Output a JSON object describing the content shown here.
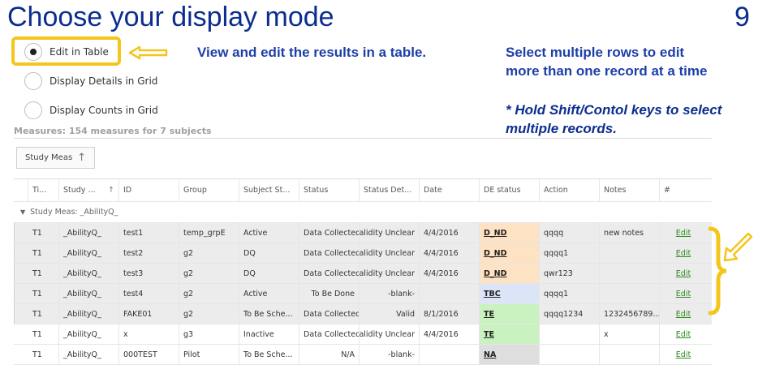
{
  "title": "Choose your display mode",
  "page_number": "9",
  "notes": {
    "view_edit": "View and edit the results in a table.",
    "select_multiple_line1": "Select multiple rows to edit",
    "select_multiple_line2": "more than one record at a time",
    "hold_keys_line1": "* Hold Shift/Contol keys to select",
    "hold_keys_line2": "multiple records."
  },
  "display_modes": [
    {
      "label": "Edit in Table",
      "selected": true
    },
    {
      "label": "Display Details in Grid",
      "selected": false
    },
    {
      "label": "Display Counts in Grid",
      "selected": false
    }
  ],
  "measures_summary": "Measures: 154 measures for 7 subjects",
  "group_by_button": "Study Meas",
  "columns": [
    "Ti...",
    "Study ...",
    "ID",
    "Group",
    "Subject St...",
    "Status",
    "Status Det...",
    "Date",
    "DE status",
    "Action",
    "Notes",
    "#"
  ],
  "group_label": "Study Meas: _AbilityQ_",
  "rows": [
    {
      "ti": "T1",
      "study": "_AbilityQ_",
      "id": "test1",
      "group": "temp_grpE",
      "subject_status": "Active",
      "status": "Data Collected",
      "status_detail": "Validity Unclear",
      "date": "4/4/2016",
      "de_status": "D_ND",
      "action": "qqqq",
      "notes": "new notes",
      "edit": "Edit"
    },
    {
      "ti": "T1",
      "study": "_AbilityQ_",
      "id": "test2",
      "group": "g2",
      "subject_status": "DQ",
      "status": "Data Collected",
      "status_detail": "Validity Unclear",
      "date": "4/4/2016",
      "de_status": "D_ND",
      "action": "qqqq1",
      "notes": "",
      "edit": "Edit"
    },
    {
      "ti": "T1",
      "study": "_AbilityQ_",
      "id": "test3",
      "group": "g2",
      "subject_status": "DQ",
      "status": "Data Collected",
      "status_detail": "Validity Unclear",
      "date": "4/4/2016",
      "de_status": "D_ND",
      "action": "qwr123",
      "notes": "",
      "edit": "Edit"
    },
    {
      "ti": "T1",
      "study": "_AbilityQ_",
      "id": "test4",
      "group": "g2",
      "subject_status": "Active",
      "status": "To Be Done",
      "status_detail": "-blank-",
      "date": "",
      "de_status": "TBC",
      "action": "qqqq1",
      "notes": "",
      "edit": "Edit"
    },
    {
      "ti": "T1",
      "study": "_AbilityQ_",
      "id": "FAKE01",
      "group": "g2",
      "subject_status": "To Be Sche...",
      "status": "Data Collected",
      "status_detail": "Valid",
      "date": "8/1/2016",
      "de_status": "TE",
      "action": "qqqq1234",
      "notes": "1232456789...",
      "edit": "Edit"
    },
    {
      "ti": "T1",
      "study": "_AbilityQ_",
      "id": "x",
      "group": "g3",
      "subject_status": "Inactive",
      "status": "Data Collected",
      "status_detail": "Validity Unclear",
      "date": "4/4/2016",
      "de_status": "TE",
      "action": "",
      "notes": "x",
      "edit": "Edit"
    },
    {
      "ti": "T1",
      "study": "_AbilityQ_",
      "id": "000TEST",
      "group": "Pilot",
      "subject_status": "To Be Sche...",
      "status": "N/A",
      "status_detail": "-blank-",
      "date": "",
      "de_status": "NA",
      "action": "",
      "notes": "",
      "edit": "Edit"
    }
  ],
  "colors": {
    "title": "#0b2d8f",
    "highlight": "#f4c51a",
    "de_d_nd": "#fde2c4",
    "de_tbc": "#dbe5f7",
    "de_te": "#c9f2c0",
    "de_na": "#dedede",
    "edit_link": "#2e8b1f"
  }
}
